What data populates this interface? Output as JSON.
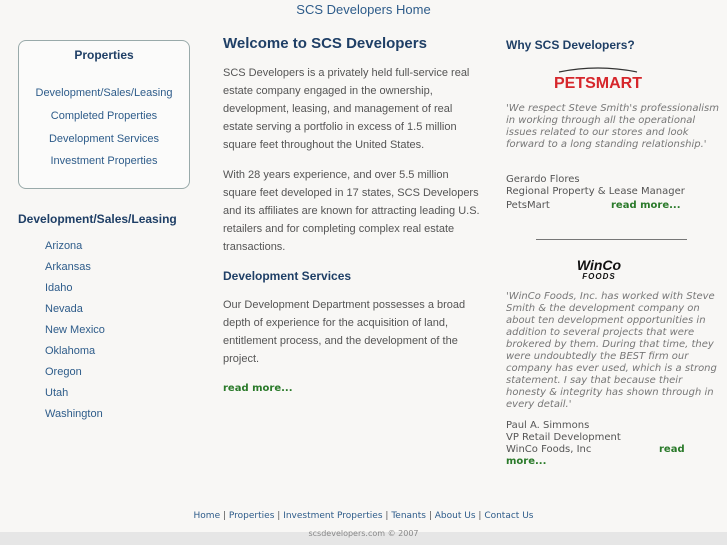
{
  "header": {
    "home_link": "SCS Developers Home"
  },
  "sidebar": {
    "properties_box": {
      "title": "Properties",
      "items": [
        "Development/Sales/Leasing",
        "Completed Properties",
        "Development Services",
        "Investment Properties"
      ]
    },
    "dsl_title": "Development/Sales/Leasing",
    "states": [
      "Arizona",
      "Arkansas",
      "Idaho",
      "Nevada",
      "New Mexico",
      "Oklahoma",
      "Oregon",
      "Utah",
      "Washington"
    ]
  },
  "main": {
    "welcome_title": "Welcome to SCS Developers",
    "para1": "SCS Developers is a privately held full-service real estate company engaged in the ownership, development, leasing, and management of real estate serving a portfolio in excess of 1.5 million square feet throughout the United States.",
    "para2": "With 28 years experience, and over 5.5 million square feet developed in 17 states, SCS Developers and its affiliates are known for attracting leading U.S. retailers and for completing complex real estate transactions.",
    "dev_title": "Development Services",
    "para3": "Our Development Department possesses a broad depth of experience for the acquisition of land, entitlement process, and the development of the project.",
    "read_more": "read more..."
  },
  "testimonials": {
    "title": "Why SCS Developers?",
    "petsmart": {
      "logo_text": "PETSMART",
      "quote": "'We respect Steve Smith's professionalism in working through all the operational issues related to our stores and look forward to a long standing relationship.'",
      "name": "Gerardo Flores",
      "role": "Regional Property & Lease Manager",
      "company": "PetsMart",
      "read_more": "read more..."
    },
    "winco": {
      "logo_text_1": "WinCo",
      "logo_text_2": "FOODS",
      "quote": "'WinCo Foods, Inc. has worked with Steve Smith & the development company on about ten development opportunities in addition to several projects that were brokered by them. During that time, they were undoubtedly the BEST firm our company has ever used, which is a strong statement. I say that because their honesty & integrity has shown through in every detail.'",
      "name": "Paul A. Simmons",
      "role": "VP Retail Development",
      "company": "WinCo Foods, Inc",
      "read_more_1": "read",
      "read_more_2": "more..."
    }
  },
  "footer": {
    "links": [
      "Home",
      "Properties",
      "Investment Properties",
      "Tenants",
      "About Us",
      "Contact Us"
    ],
    "separator": "|",
    "copyright": "scsdevelopers.com © 2007"
  },
  "colors": {
    "link": "#2e5c8a",
    "heading": "#1f3f66",
    "read_more": "#2a7a2a",
    "petsmart_red": "#d6262b"
  }
}
